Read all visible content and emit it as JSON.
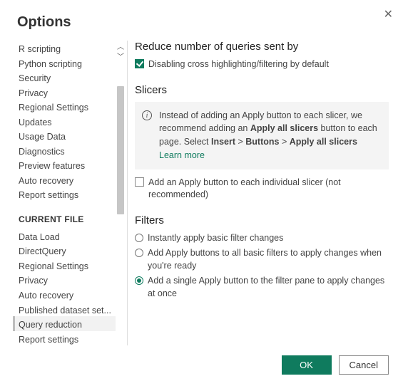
{
  "dialog": {
    "title": "Options",
    "close_label": "Close"
  },
  "sidebar": {
    "global_items": [
      "R scripting",
      "Python scripting",
      "Security",
      "Privacy",
      "Regional Settings",
      "Updates",
      "Usage Data",
      "Diagnostics",
      "Preview features",
      "Auto recovery",
      "Report settings"
    ],
    "current_file_header": "CURRENT FILE",
    "current_items": [
      "Data Load",
      "DirectQuery",
      "Regional Settings",
      "Privacy",
      "Auto recovery",
      "Published dataset set...",
      "Query reduction",
      "Report settings"
    ],
    "selected": "Query reduction"
  },
  "content": {
    "reduce_heading": "Reduce number of queries sent by",
    "disable_cross": "Disabling cross highlighting/filtering by default",
    "slicers_heading": "Slicers",
    "info_pre": "Instead of adding an Apply button to each slicer, we recommend adding an ",
    "info_bold1": "Apply all slicers",
    "info_mid": " button to each page. Select ",
    "info_bold2": "Insert",
    "info_gt": " > ",
    "info_bold3": "Buttons",
    "info_bold4": "Apply all slicers",
    "learn_more": "Learn more",
    "slicer_checkbox": "Add an Apply button to each individual slicer (not recommended)",
    "filters_heading": "Filters",
    "filter_opts": [
      "Instantly apply basic filter changes",
      "Add Apply buttons to all basic filters to apply changes when you're ready",
      "Add a single Apply button to the filter pane to apply changes at once"
    ],
    "filter_selected_index": 2
  },
  "footer": {
    "ok": "OK",
    "cancel": "Cancel"
  }
}
